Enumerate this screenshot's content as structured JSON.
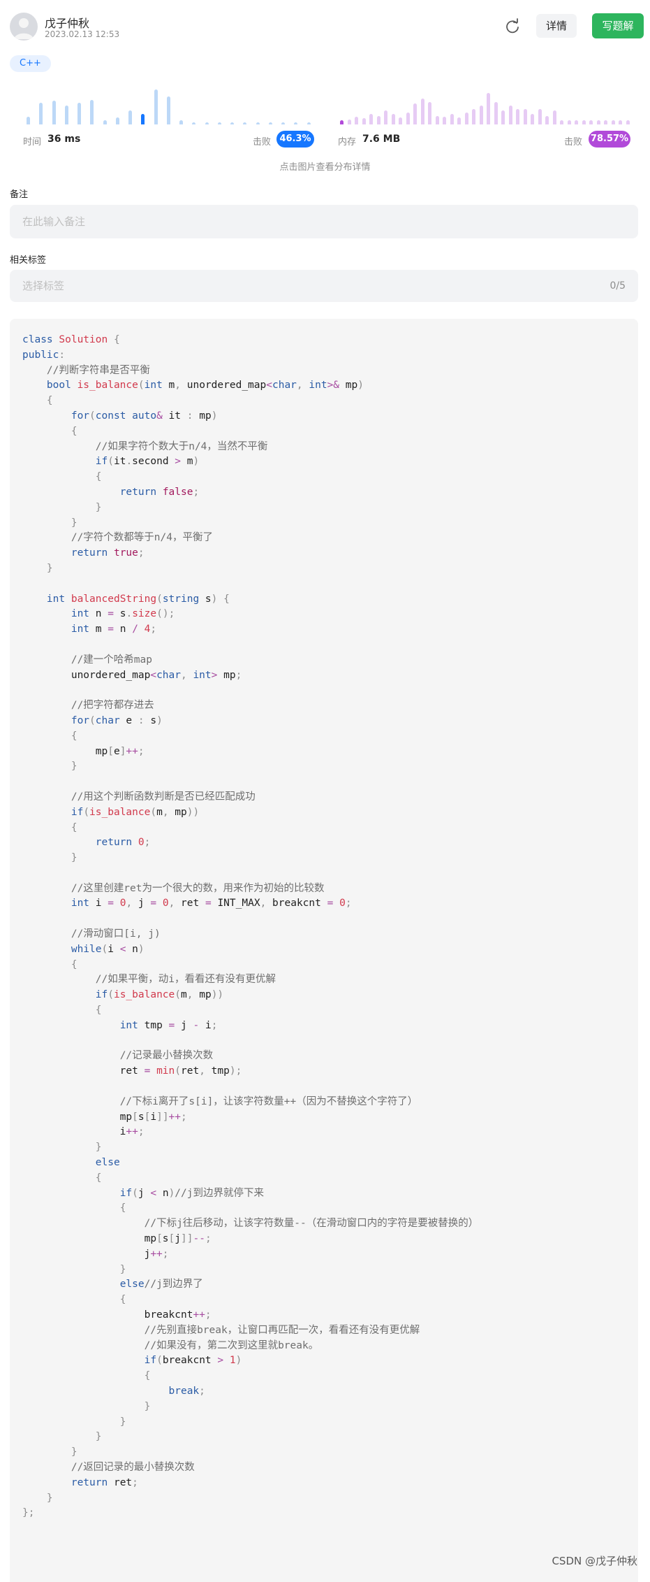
{
  "header": {
    "username": "戊子仲秋",
    "date": "2023.02.13 12:53",
    "detail_label": "详情",
    "write_solution_label": "写题解"
  },
  "language_tag": "C++",
  "stats": {
    "time_label": "时间",
    "time_value": "36 ms",
    "time_beat_label": "击败",
    "time_beat_value": "46.3%",
    "memory_label": "内存",
    "memory_value": "7.6 MB",
    "memory_beat_label": "击败",
    "memory_beat_value": "78.57%",
    "hint": "点击图片查看分布详情",
    "colors": {
      "time_accent": "#1677ff",
      "time_bar": "#bcd8f7",
      "memory_accent": "#b14ad9",
      "memory_bar": "#e6cbf4"
    }
  },
  "chart_data": [
    {
      "type": "bar",
      "title": "",
      "values": [
        0.22,
        0.62,
        0.68,
        0.55,
        0.62,
        0.7,
        0.12,
        0.2,
        0.4,
        0.3,
        1.0,
        0.8,
        0.12,
        0.05,
        0.05,
        0.05,
        0.05,
        0.05,
        0.05,
        0.05,
        0.05,
        0.05,
        0.05
      ],
      "highlight_index": 9
    },
    {
      "type": "bar",
      "title": "",
      "values": [
        0.12,
        0.15,
        0.22,
        0.18,
        0.3,
        0.25,
        0.4,
        0.3,
        0.2,
        0.35,
        0.6,
        0.75,
        0.65,
        0.25,
        0.22,
        0.3,
        0.2,
        0.35,
        0.45,
        0.55,
        0.9,
        0.65,
        0.4,
        0.55,
        0.45,
        0.45,
        0.3,
        0.45,
        0.25,
        0.4,
        0.12,
        0.12,
        0.12,
        0.12,
        0.12,
        0.12,
        0.12,
        0.12,
        0.12,
        0.12
      ],
      "highlight_index": 0
    }
  ],
  "remark": {
    "label": "备注",
    "placeholder": "在此输入备注"
  },
  "tags": {
    "label": "相关标签",
    "placeholder": "选择标签",
    "count": "0/5"
  },
  "watermark": "CSDN @戊子仲秋",
  "code": "class Solution {\npublic:\n    //判断字符串是否平衡\n    bool is_balance(int m, unordered_map<char, int>& mp)\n    {\n        for(const auto& it : mp)\n        {\n            //如果字符个数大于n/4，当然不平衡\n            if(it.second > m)\n            {\n                return false;\n            }\n        }\n        //字符个数都等于n/4，平衡了\n        return true;\n    }\n\n    int balancedString(string s) {\n        int n = s.size();\n        int m = n / 4;\n\n        //建一个哈希map\n        unordered_map<char, int> mp;\n\n        //把字符都存进去\n        for(char e : s)\n        {\n            mp[e]++;\n        }\n\n        //用这个判断函数判断是否已经匹配成功\n        if(is_balance(m, mp))\n        {\n            return 0;\n        }\n\n        //这里创建ret为一个很大的数，用来作为初始的比较数\n        int i = 0, j = 0, ret = INT_MAX, breakcnt = 0;\n\n        //滑动窗口[i, j)\n        while(i < n)\n        {\n            //如果平衡，动i，看看还有没有更优解\n            if(is_balance(m, mp))\n            {\n                int tmp = j - i;\n\n                //记录最小替换次数\n                ret = min(ret, tmp);\n\n                //下标i离开了s[i]，让该字符数量++（因为不替换这个字符了）\n                mp[s[i]]++;\n                i++;\n            }\n            else\n            {\n                if(j < n)//j到边界就停下来\n                {\n                    //下标j往后移动，让该字符数量--（在滑动窗口内的字符是要被替换的）\n                    mp[s[j]]--;\n                    j++;\n                }\n                else//j到边界了\n                {\n                    breakcnt++;\n                    //先别直接break，让窗口再匹配一次，看看还有没有更优解\n                    //如果没有，第二次到这里就break。\n                    if(breakcnt > 1)\n                    {\n                        break;\n                    }\n                }\n            }\n        }\n        //返回记录的最小替换次数\n        return ret;\n    }\n};"
}
